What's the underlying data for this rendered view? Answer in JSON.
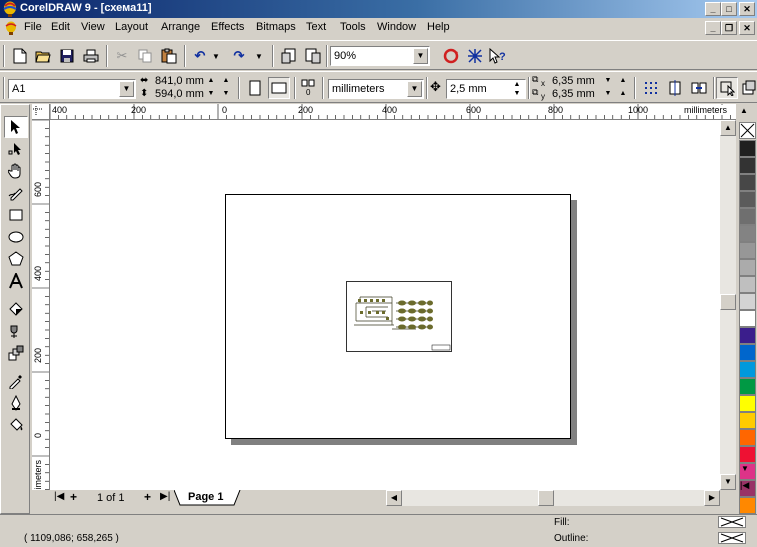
{
  "window": {
    "title": "CorelDRAW 9 - [схема11]",
    "minimize": "_",
    "maximize": "□",
    "close": "✕"
  },
  "menu": {
    "items": [
      "File",
      "Edit",
      "View",
      "Layout",
      "Arrange",
      "Effects",
      "Bitmaps",
      "Text",
      "Tools",
      "Window",
      "Help"
    ],
    "doc_minimize": "_",
    "doc_restore": "❐",
    "doc_close": "✕"
  },
  "standard_toolbar": {
    "zoom_value": "90%"
  },
  "property_bar": {
    "paper_type": "A1",
    "page_width": "841,0 mm",
    "page_height": "594,0 mm",
    "units": "millimeters",
    "nudge": "2,5 mm",
    "dup_x": "6,35 mm",
    "dup_y": "6,35 mm",
    "x_label": "x",
    "y_label": "y"
  },
  "rulers": {
    "horizontal_labels": [
      "400",
      "200",
      "0",
      "200",
      "400",
      "600",
      "800",
      "1000"
    ],
    "horizontal_unit": "millimeters",
    "vertical_labels": [
      "600",
      "400",
      "200",
      "0"
    ],
    "vertical_unit": "millimeters"
  },
  "page_nav": {
    "page_count": "1 of 1",
    "page_tab": "Page 1"
  },
  "palette": {
    "colors": [
      "#ffffff",
      "#202020",
      "#333333",
      "#474747",
      "#5b5b5b",
      "#6f6f6f",
      "#838383",
      "#979797",
      "#ababab",
      "#bfbfbf",
      "#d3d3d3",
      "#ffffff",
      "#3b1e8c",
      "#0066cc",
      "#0099dd",
      "#009944",
      "#ffff00",
      "#ffcc00",
      "#ff6600",
      "#ee1133",
      "#dd3388",
      "#993366",
      "#ff8800"
    ]
  },
  "status": {
    "coords": "( 1109,086; 658,265 )",
    "fill_label": "Fill:",
    "outline_label": "Outline:"
  },
  "colors": {
    "title_gradient_start": "#0a246a",
    "title_gradient_end": "#a6caf0",
    "chrome": "#d4d0c8"
  }
}
